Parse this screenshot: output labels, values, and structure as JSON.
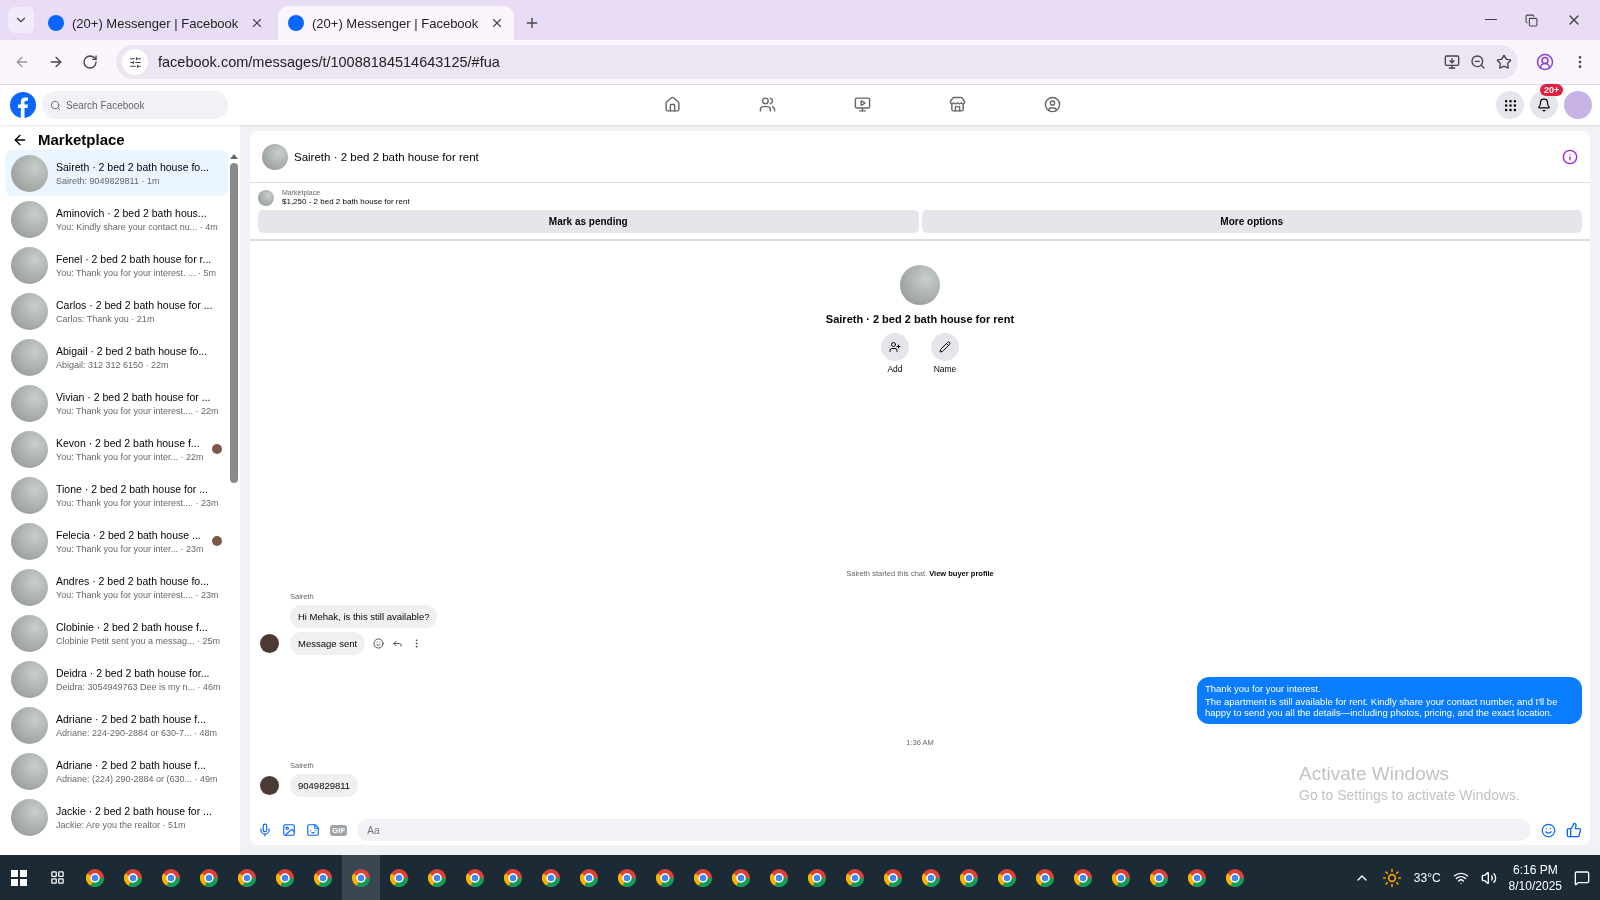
{
  "browser": {
    "tabs": [
      {
        "title": "(20+) Messenger | Facebook",
        "selected": false
      },
      {
        "title": "(20+) Messenger | Facebook",
        "selected": true
      }
    ],
    "url": "facebook.com/messages/t/10088184514643125/#fua"
  },
  "topbar": {
    "search_placeholder": "Search Facebook",
    "nav": [
      {
        "kind": "home",
        "selected": false
      },
      {
        "kind": "friends",
        "selected": false
      },
      {
        "kind": "video",
        "selected": false
      },
      {
        "kind": "marketplace",
        "selected": false
      },
      {
        "kind": "groups",
        "selected": false
      }
    ],
    "notification_badge": "20+"
  },
  "sidebar": {
    "title": "Marketplace",
    "conversations": [
      {
        "title": "Saireth · 2 bed 2 bath house fo...",
        "preview": "Saireth: 9049829811 · 1m",
        "selected": true,
        "seen": false
      },
      {
        "title": "Aminovich · 2 bed 2 bath hous...",
        "preview": "You: Kindly share your contact nu... · 4m",
        "selected": false,
        "seen": false
      },
      {
        "title": "Fenel · 2 bed 2 bath house for r...",
        "preview": "You: Thank you for your interest. ... · 5m",
        "selected": false,
        "seen": false
      },
      {
        "title": "Carlos · 2 bed 2 bath house for ...",
        "preview": "Carlos: Thank you · 21m",
        "selected": false,
        "seen": false
      },
      {
        "title": "Abigail · 2 bed 2 bath house fo...",
        "preview": "Abigail: 312 312 6150 · 22m",
        "selected": false,
        "seen": false
      },
      {
        "title": "Vivian · 2 bed 2 bath house for ...",
        "preview": "You: Thank you for your interest.... · 22m",
        "selected": false,
        "seen": false
      },
      {
        "title": "Kevon · 2 bed 2 bath house f...",
        "preview": "You: Thank you for your inter... · 22m",
        "selected": false,
        "seen": true
      },
      {
        "title": "Tione · 2 bed 2 bath house for ...",
        "preview": "You: Thank you for your interest.... · 23m",
        "selected": false,
        "seen": false
      },
      {
        "title": "Felecia · 2 bed 2 bath house ...",
        "preview": "You: Thank you for your inter... · 23m",
        "selected": false,
        "seen": true
      },
      {
        "title": "Andres · 2 bed 2 bath house fo...",
        "preview": "You: Thank you for your interest.... · 23m",
        "selected": false,
        "seen": false
      },
      {
        "title": "Clobinie · 2 bed 2 bath house f...",
        "preview": "Clobinie Petit sent you a messag... · 25m",
        "selected": false,
        "seen": false
      },
      {
        "title": "Deidra · 2 bed 2 bath house for...",
        "preview": "Deidra: 3054949763 Dee is my n... · 46m",
        "selected": false,
        "seen": false
      },
      {
        "title": "Adriane · 2 bed 2 bath house f...",
        "preview": "Adriane: 224-290-2884 or 630-7... · 48m",
        "selected": false,
        "seen": false
      },
      {
        "title": "Adriane · 2 bed 2 bath house f...",
        "preview": "Adriane: (224) 290-2884 or (630... · 49m",
        "selected": false,
        "seen": false
      },
      {
        "title": "Jackie · 2 bed 2 bath house for ...",
        "preview": "Jackie: Are you the realtor · 51m",
        "selected": false,
        "seen": false
      }
    ]
  },
  "chat": {
    "title": "Saireth · 2 bed 2 bath house for rent",
    "listing": {
      "label": "Marketplace",
      "text": "$1,250 - 2 bed 2 bath house for rent",
      "buttons": [
        "Mark as pending",
        "More options"
      ]
    },
    "profile": {
      "name": "Saireth · 2 bed 2 bath house for rent",
      "actions": [
        {
          "kind": "add",
          "label": "Add"
        },
        {
          "kind": "name",
          "label": "Name"
        }
      ]
    },
    "started": {
      "text": "Saireth started this chat.",
      "link": "View buyer profile"
    },
    "messages": [
      {
        "kind": "incoming",
        "sender": "Saireth",
        "bubbles": [
          "Hi Mehak, is this still available?",
          "Message sent"
        ]
      },
      {
        "kind": "outgoing",
        "lines": [
          "Thank you for your interest.",
          "The apartment is still available for rent. Kindly share your contact number, and I'll be happy to send you all the details—including photos, pricing, and the exact location."
        ]
      },
      {
        "kind": "timestamp",
        "text": "1:36 AM"
      },
      {
        "kind": "incoming",
        "sender": "Saireth",
        "bubbles": [
          "9049829811"
        ]
      }
    ],
    "composer_placeholder": "Aa",
    "gif_label": "GIF"
  },
  "activation": {
    "title": "Activate Windows",
    "subtitle": "Go to Settings to activate Windows."
  },
  "taskbar": {
    "temperature": "33°C",
    "time": "6:16 PM",
    "date": "8/10/2025"
  }
}
